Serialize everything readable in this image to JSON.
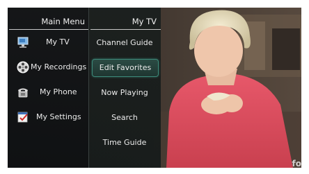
{
  "main_menu": {
    "title": "Main Menu",
    "items": [
      {
        "label": "My TV",
        "icon": "tv-monitor-icon"
      },
      {
        "label": "My Recordings",
        "icon": "film-reel-icon"
      },
      {
        "label": "My Phone",
        "icon": "phone-icon"
      },
      {
        "label": "My Settings",
        "icon": "settings-checklist-icon"
      }
    ]
  },
  "sub_menu": {
    "title": "My TV",
    "items": [
      {
        "label": "Channel Guide"
      },
      {
        "label": "Edit Favorites",
        "selected": true
      },
      {
        "label": "Now Playing"
      },
      {
        "label": "Search"
      },
      {
        "label": "Time Guide"
      }
    ]
  },
  "video": {
    "channel_logo": "fo"
  },
  "colors": {
    "selection_border": "#3d8a7a",
    "menu_background": "#141618",
    "text": "#ececec"
  }
}
